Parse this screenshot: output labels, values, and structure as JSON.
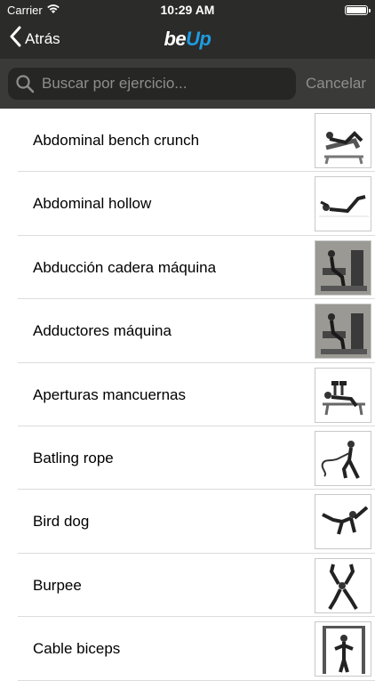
{
  "status": {
    "carrier": "Carrier",
    "time": "10:29 AM"
  },
  "nav": {
    "back_label": "Atrás",
    "logo_be": "be",
    "logo_up": "Up"
  },
  "search": {
    "placeholder": "Buscar por ejercicio...",
    "value": "",
    "cancel_label": "Cancelar"
  },
  "exercises": [
    {
      "name": "Abdominal bench crunch",
      "thumb": "bench-crunch"
    },
    {
      "name": "Abdominal hollow",
      "thumb": "hollow"
    },
    {
      "name": "Abducción cadera máquina",
      "thumb": "machine"
    },
    {
      "name": "Adductores máquina",
      "thumb": "machine"
    },
    {
      "name": "Aperturas mancuernas",
      "thumb": "bench-press"
    },
    {
      "name": "Batling rope",
      "thumb": "rope"
    },
    {
      "name": "Bird dog",
      "thumb": "bird-dog"
    },
    {
      "name": "Burpee",
      "thumb": "burpee"
    },
    {
      "name": "Cable biceps",
      "thumb": "cable"
    }
  ]
}
